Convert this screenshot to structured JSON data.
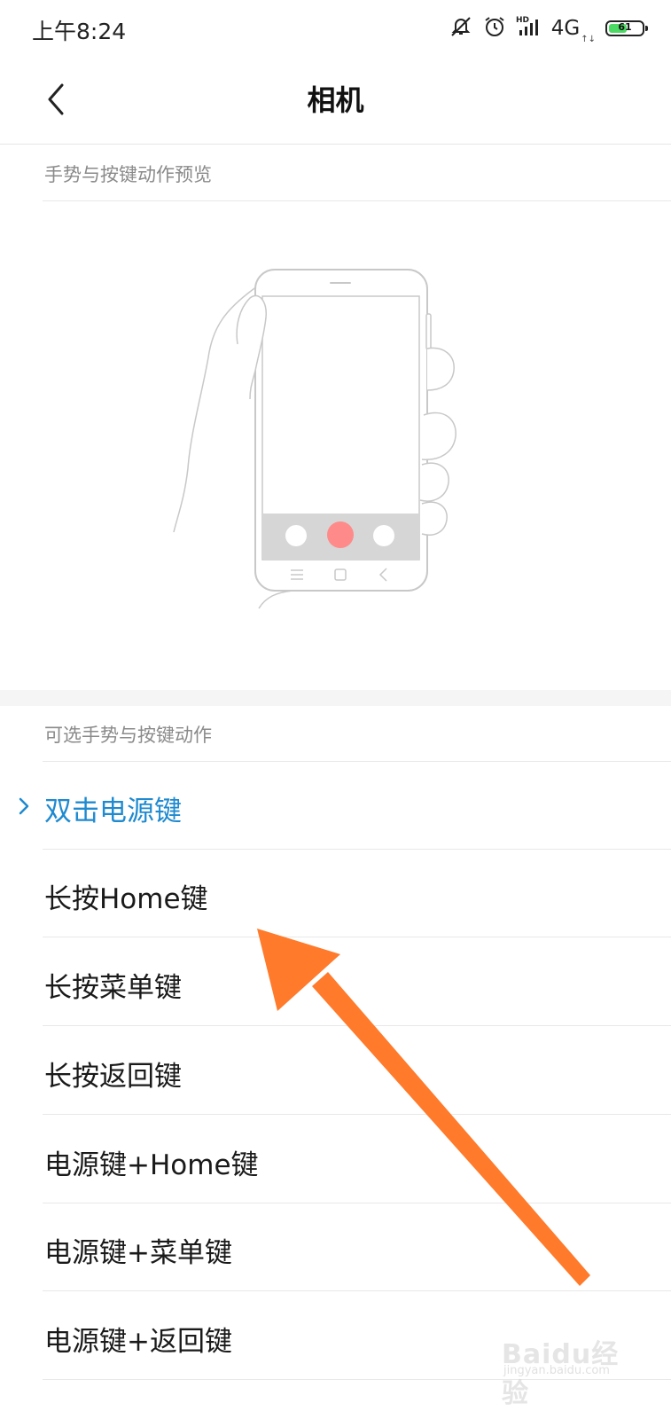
{
  "status_bar": {
    "time": "上午8:24",
    "network": "4G",
    "network_sub": "↑↓",
    "battery_level": 61,
    "battery_text": "61",
    "battery_color": "#4cd964",
    "icons": [
      "mute-icon",
      "alarm-icon",
      "hd-signal-icon",
      "battery-icon"
    ]
  },
  "header": {
    "title": "相机",
    "back_icon": "chevron-left-icon"
  },
  "preview_section": {
    "label": "手势与按键动作预览",
    "illustration": "hand-holding-phone-camera"
  },
  "options_section": {
    "label": "可选手势与按键动作",
    "items": [
      {
        "label": "双击电源键",
        "selected": true
      },
      {
        "label": "长按Home键",
        "selected": false
      },
      {
        "label": "长按菜单键",
        "selected": false
      },
      {
        "label": "长按返回键",
        "selected": false
      },
      {
        "label": "电源键+Home键",
        "selected": false
      },
      {
        "label": "电源键+菜单键",
        "selected": false
      },
      {
        "label": "电源键+返回键",
        "selected": false
      }
    ]
  },
  "colors": {
    "accent": "#1f8ad0",
    "arrow": "#ff7a2a",
    "record": "#ff8a8a"
  },
  "watermark": {
    "text": "Baidu经验",
    "sub": "jingyan.baidu.com"
  }
}
